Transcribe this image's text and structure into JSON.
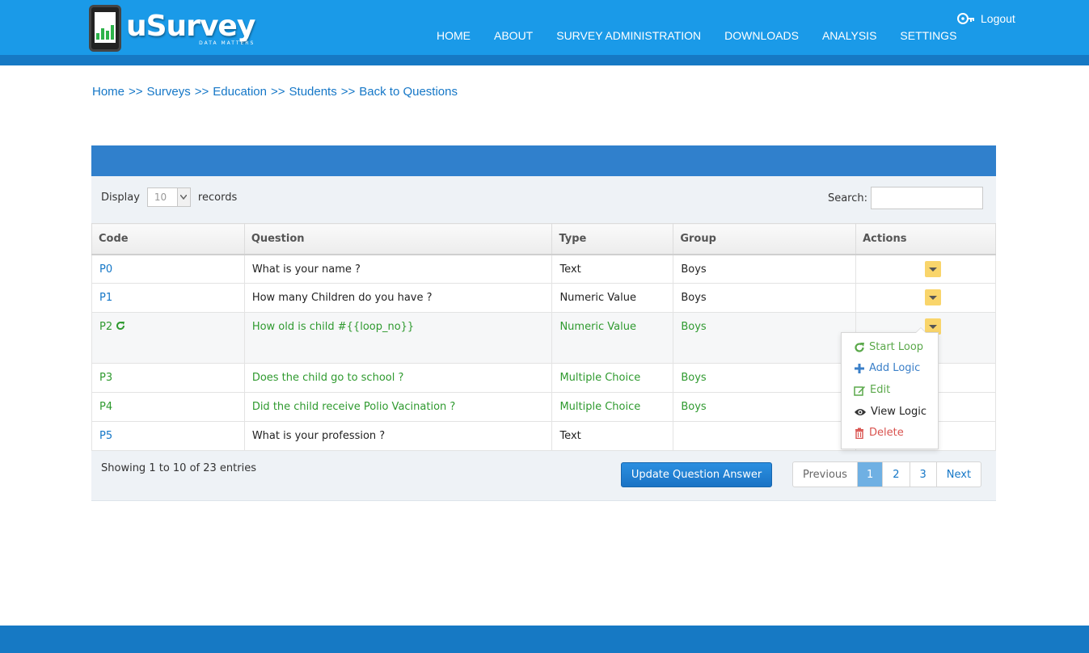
{
  "brand": {
    "name": "uSurvey",
    "tagline": "DATA MATTERS"
  },
  "nav": [
    "HOME",
    "ABOUT",
    "SURVEY ADMINISTRATION",
    "DOWNLOADS",
    "ANALYSIS",
    "SETTINGS"
  ],
  "logout_label": "Logout",
  "breadcrumb": [
    "Home",
    "Surveys",
    "Education",
    "Students",
    "Back to Questions"
  ],
  "breadcrumb_sep": ">>",
  "table_controls": {
    "display_label": "Display",
    "records_label": "records",
    "page_size": "10",
    "search_label": "Search:",
    "search_value": ""
  },
  "columns": [
    "Code",
    "Question",
    "Type",
    "Group",
    "Actions"
  ],
  "rows": [
    {
      "code": "P0",
      "question": "What is your name ?",
      "type": "Text",
      "group": "Boys"
    },
    {
      "code": "P1",
      "question": "How many Children do you have ?",
      "type": "Numeric Value",
      "group": "Boys"
    },
    {
      "code": "P2",
      "question": "How old is child #{{loop_no}}",
      "type": "Numeric Value",
      "group": "Boys"
    },
    {
      "code": "P3",
      "question": "Does the child go to school ?",
      "type": "Multiple Choice",
      "group": "Boys"
    },
    {
      "code": "P4",
      "question": "Did the child receive Polio Vacination ?",
      "type": "Multiple Choice",
      "group": "Boys"
    },
    {
      "code": "P5",
      "question": "What is your profession ?",
      "type": "Text",
      "group": ""
    }
  ],
  "action_menu": [
    "Start Loop",
    "Add Logic",
    "Edit",
    "View Logic",
    "Delete"
  ],
  "showing_text": "Showing 1 to 10 of 23 entries",
  "update_button": "Update Question Answer",
  "pagination": {
    "previous": "Previous",
    "pages": [
      "1",
      "2",
      "3"
    ],
    "active": "1",
    "next": "Next"
  },
  "colors": {
    "header": "#1a9ae8",
    "header_strip": "#1679c4",
    "link": "#1577c7",
    "green": "#2f9a2f",
    "delete": "#d9534f",
    "caret_button": "#f9d56b"
  }
}
